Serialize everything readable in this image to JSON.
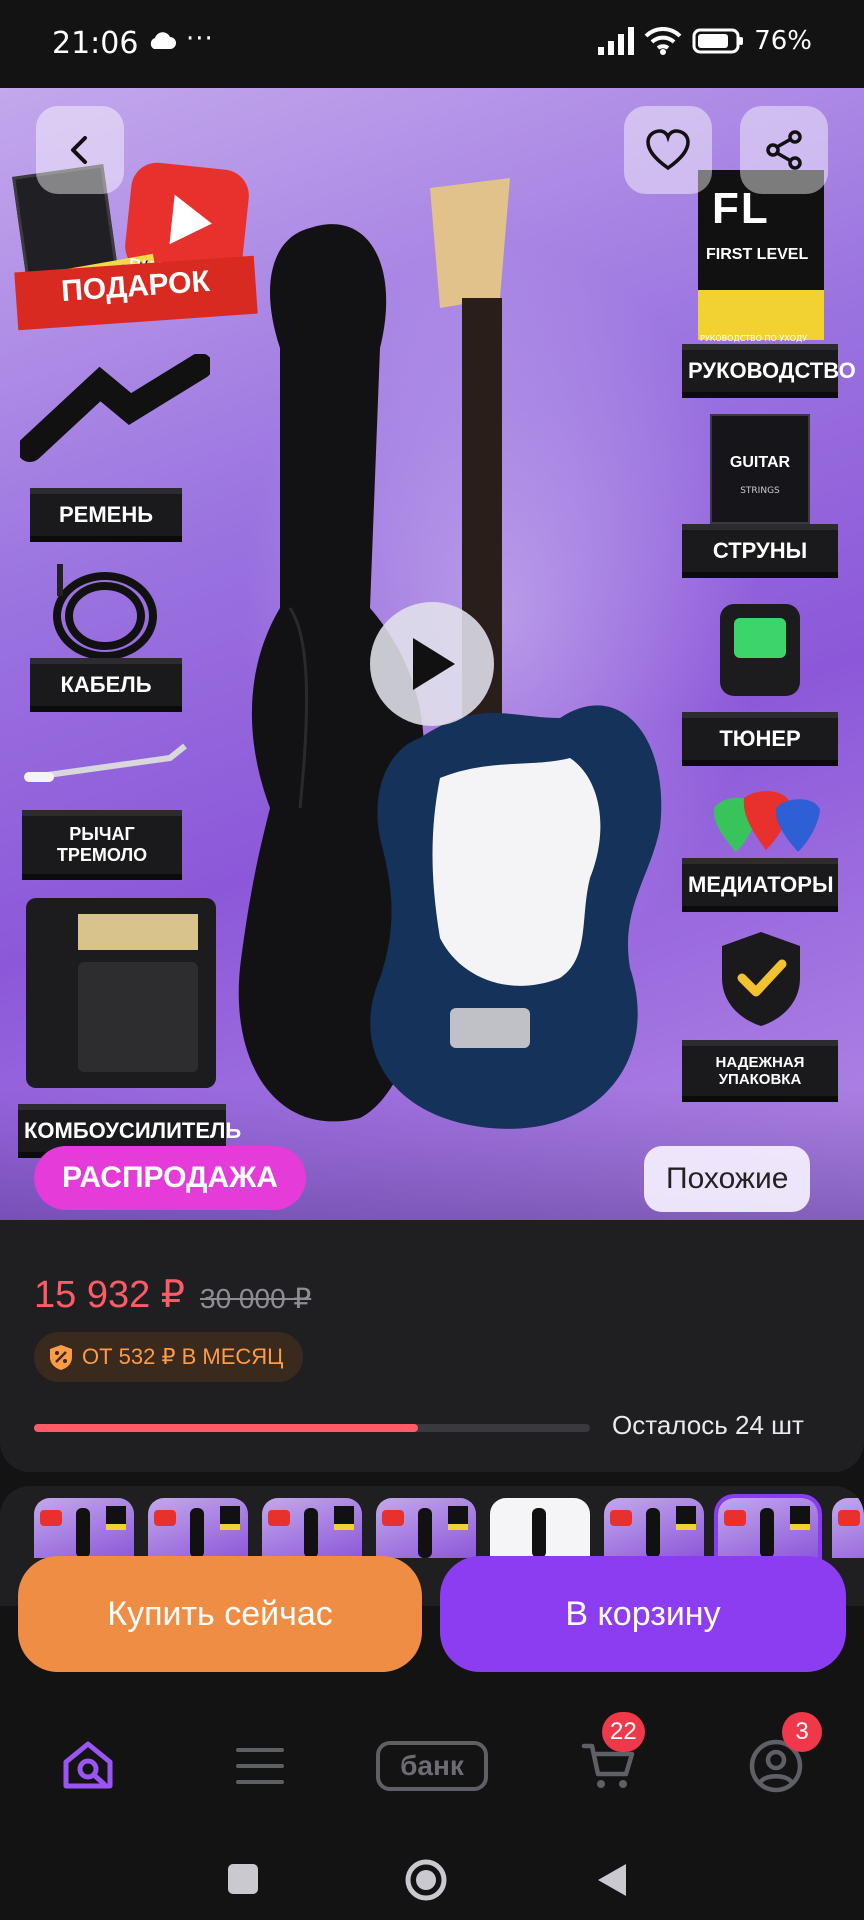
{
  "status_bar": {
    "time": "21:06",
    "dots": "···",
    "battery": "76%"
  },
  "hero": {
    "gift_tag_sticker": "СТИКЕРПАК",
    "gift_tag_course": "ВИДЕОКУРС",
    "gift_label": "ПОДАРОК",
    "brand_logo": "FL",
    "brand_name": "FIRST LEVEL",
    "brand_caption": "РУКОВОДСТВО ПО УХОДУ",
    "strings_brand": "GUITAR",
    "strings_sub": "STRINGS",
    "left_items": [
      "РЕМЕНЬ",
      "КАБЕЛЬ",
      "РЫЧАГ ТРЕМОЛО",
      "КОМБОУСИЛИТЕЛЬ"
    ],
    "right_items": [
      "РУКОВОДСТВО",
      "СТРУНЫ",
      "ТЮНЕР",
      "МЕДИАТОРЫ",
      "НАДЕЖНАЯ УПАКОВКА"
    ],
    "sale_badge": "РАСПРОДАЖА",
    "similar_button": "Похожие"
  },
  "product": {
    "price": "15 932 ₽",
    "old_price": "30 000 ₽",
    "installment": "ОТ 532 ₽ В МЕСЯЦ",
    "stock_fraction": 0.69,
    "stock_text": "Осталось 24 шт"
  },
  "actions": {
    "buy_now": "Купить сейчас",
    "add_to_cart": "В корзину"
  },
  "tabbar": {
    "bank_label": "банк",
    "cart_badge": "22",
    "profile_badge": "3"
  },
  "colors": {
    "accent": "#8c3df2",
    "buy": "#ef8d45",
    "price": "#ff5b67",
    "sale": "#e53bd8"
  }
}
